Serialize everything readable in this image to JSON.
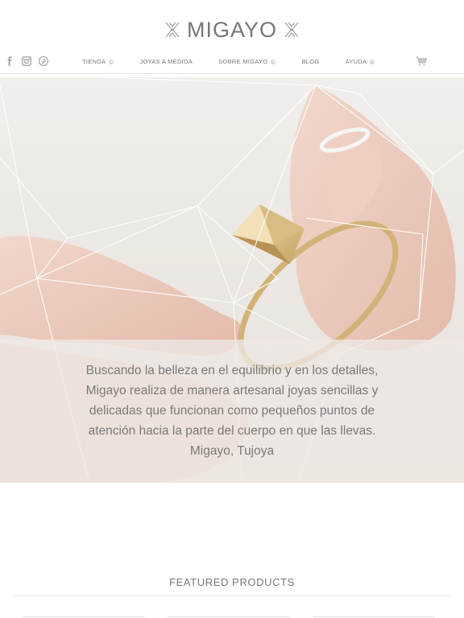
{
  "brand": {
    "name": "MIGAYO"
  },
  "social_icons": [
    "facebook-icon",
    "instagram-icon",
    "pinterest-icon"
  ],
  "nav": {
    "items": [
      {
        "label": "TIENDA",
        "has_submenu": true
      },
      {
        "label": "JOYAS A MEDIDA",
        "has_submenu": false
      },
      {
        "label": "SOBRE MIGAYO",
        "has_submenu": true
      },
      {
        "label": "BLOG",
        "has_submenu": false
      },
      {
        "label": "AYUDA",
        "has_submenu": true
      }
    ]
  },
  "cart_icon": "shopping-cart-icon",
  "hero": {
    "lines": [
      "Buscando la belleza en el equilibrio y en los detalles,",
      "Migayo realiza de manera artesanal joyas sencillas y",
      "delicadas que funcionan como pequeños puntos de",
      "atención hacia la parte del cuerpo en que las llevas.",
      "Migayo, Tujoya"
    ]
  },
  "featured": {
    "title": "FEATURED PRODUCTS"
  },
  "colors": {
    "text": "#777777",
    "accent_gold": "#d9c08a",
    "skin": "#e9c8b9",
    "background": "#ffffff"
  }
}
